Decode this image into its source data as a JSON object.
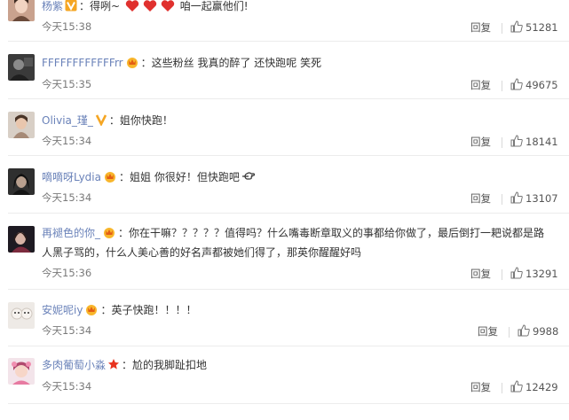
{
  "reply_label": "回复",
  "comments": [
    {
      "user": "杨紫",
      "badge": "vip-v-gold",
      "text_before": "：得咧~",
      "text_after": "咱一起赢他们!",
      "time": "今天15:38",
      "likes": "51281"
    },
    {
      "user": "FFFFFFFFFFFFrr",
      "badge": "crown-badge",
      "text": "：这些粉丝 我真的醉了 还快跑呢 笑死",
      "time": "今天15:35",
      "likes": "49675"
    },
    {
      "user": "Olivia_瑾_",
      "badge": "vip-v-gold",
      "text": "：姐你快跑！",
      "time": "今天15:34",
      "likes": "18141"
    },
    {
      "user": "嘀嘀呀Lydia",
      "badge": "crown-badge",
      "text": "：姐姐 你很好！但快跑吧",
      "time": "今天15:34",
      "likes": "13107"
    },
    {
      "user": "再褪色的你_",
      "badge": "crown-badge",
      "text_line1": "：你在干嘛？？？？？值得吗？什么嘴毒断章取义的事都给你做了，最后倒打一耙说都是路",
      "text_line2": "人黑子骂的，什么人美心善的好名声都被她们得了，那英你醒醒好吗",
      "time": "今天15:36",
      "likes": "13291"
    },
    {
      "user": "安妮呢iy",
      "badge": "crown-badge",
      "text": "：英子快跑！！！！",
      "time": "今天15:34",
      "likes": "9988"
    },
    {
      "user": "多肉葡萄小淼",
      "badge": "star-badge",
      "text": "：尬的我脚趾扣地",
      "time": "今天15:34",
      "likes": "12429"
    }
  ]
}
